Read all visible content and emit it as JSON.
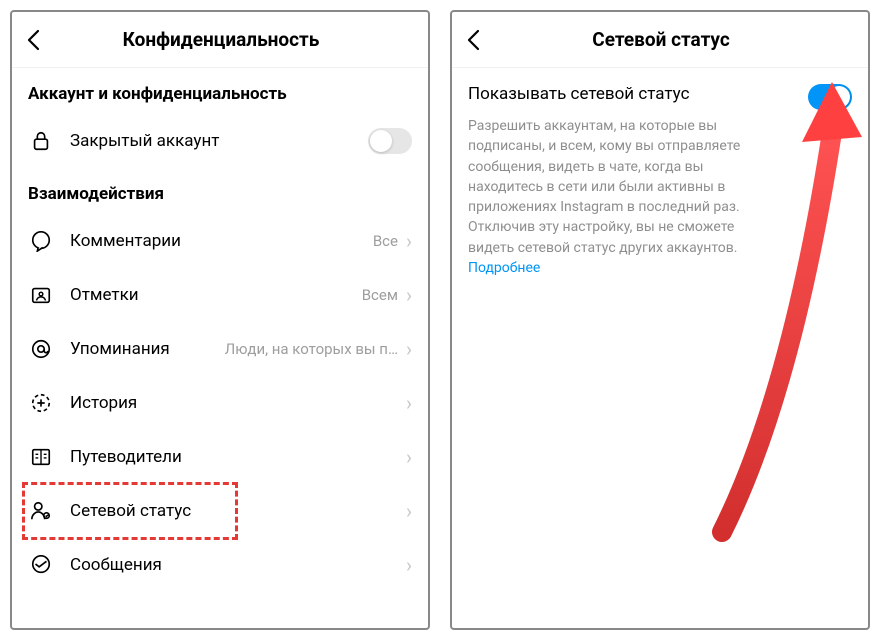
{
  "left": {
    "header_title": "Конфиденциальность",
    "section1_title": "Аккаунт и конфиденциальность",
    "private_account_label": "Закрытый аккаунт",
    "private_account_on": false,
    "section2_title": "Взаимодействия",
    "rows": [
      {
        "label": "Комментарии",
        "value": "Все"
      },
      {
        "label": "Отметки",
        "value": "Всем"
      },
      {
        "label": "Упоминания",
        "value": "Люди, на которых вы п…"
      },
      {
        "label": "История",
        "value": ""
      },
      {
        "label": "Путеводители",
        "value": ""
      },
      {
        "label": "Сетевой статус",
        "value": ""
      },
      {
        "label": "Сообщения",
        "value": ""
      }
    ]
  },
  "right": {
    "header_title": "Сетевой статус",
    "setting_title": "Показывать сетевой статус",
    "setting_on": true,
    "setting_desc": "Разрешить аккаунтам, на которые вы подписаны, и всем, кому вы отправляете сообщения, видеть в чате, когда вы находитесь в сети или были активны в приложениях Instagram в последний раз. Отключив эту настройку, вы не сможете видеть сетевой статус других аккаунтов.",
    "learn_more": "Подробнее"
  }
}
